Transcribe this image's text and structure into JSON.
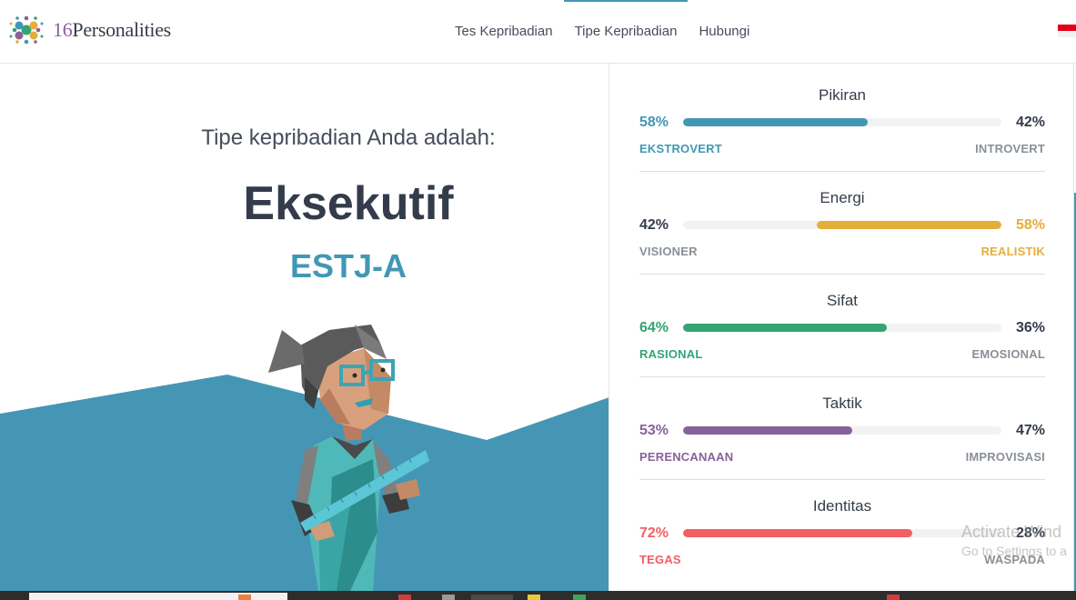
{
  "header": {
    "logo_text_num": "16",
    "logo_text_word": "Personalities",
    "nav": [
      {
        "label": "Tes Kepribadian"
      },
      {
        "label": "Tipe Kepribadian",
        "active": true
      },
      {
        "label": "Hubungi"
      }
    ],
    "language_flag": "indonesia-flag-icon"
  },
  "hero": {
    "subtitle": "Tipe kepribadian Anda adalah:",
    "type_name": "Eksekutif",
    "type_code": "ESTJ-A",
    "illustration": "executive-character-illustration"
  },
  "traits": [
    {
      "title": "Pikiran",
      "left_pct": "58%",
      "right_pct": "42%",
      "left_label": "EKSTROVERT",
      "right_label": "INTROVERT",
      "value": 58,
      "side": "left",
      "color": "#4298b4"
    },
    {
      "title": "Energi",
      "left_pct": "42%",
      "right_pct": "58%",
      "left_label": "VISIONER",
      "right_label": "REALISTIK",
      "value": 58,
      "side": "right",
      "color": "#e4ae3a"
    },
    {
      "title": "Sifat",
      "left_pct": "64%",
      "right_pct": "36%",
      "left_label": "RASIONAL",
      "right_label": "EMOSIONAL",
      "value": 64,
      "side": "left",
      "color": "#33a474"
    },
    {
      "title": "Taktik",
      "left_pct": "53%",
      "right_pct": "47%",
      "left_label": "PERENCANAAN",
      "right_label": "IMPROVISASI",
      "value": 53,
      "side": "left",
      "color": "#88619a"
    },
    {
      "title": "Identitas",
      "left_pct": "72%",
      "right_pct": "28%",
      "left_label": "TEGAS",
      "right_label": "WASPADA",
      "value": 72,
      "side": "left",
      "color": "#f25e62"
    }
  ],
  "watermark": {
    "line1": "Activate Wind",
    "line2": "Go to Settings to a"
  },
  "colors": {
    "accent": "#4298b4",
    "dark_text": "#343c4b",
    "muted_text": "#8a9097"
  }
}
